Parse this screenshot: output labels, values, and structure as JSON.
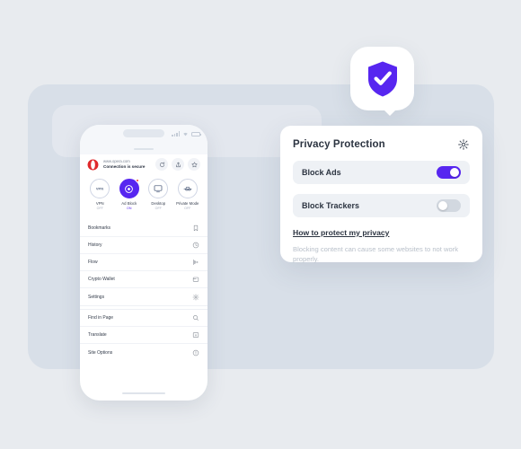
{
  "phone": {
    "status_bar": {
      "signal_icon": "signal-bars-icon",
      "wifi_icon": "wifi-icon",
      "battery_icon": "battery-icon"
    },
    "address_bar": {
      "brand_icon": "opera-logo-icon",
      "url": "www.opera.com",
      "security_text": "Connection is secure",
      "actions": [
        {
          "name": "reload-button",
          "icon": "reload-icon"
        },
        {
          "name": "share-button",
          "icon": "share-icon"
        },
        {
          "name": "bookmark-button",
          "icon": "star-icon"
        }
      ]
    },
    "quick_actions": [
      {
        "label": "VPN",
        "state": "OFF",
        "active": false,
        "icon": "vpn-icon"
      },
      {
        "label": "Ad Block",
        "state": "ON",
        "active": true,
        "icon": "adblock-icon",
        "badge": true
      },
      {
        "label": "Desktop",
        "state": "OFF",
        "active": false,
        "icon": "desktop-icon"
      },
      {
        "label": "Private Mode",
        "state": "OFF",
        "active": false,
        "icon": "private-mode-icon"
      }
    ],
    "menu_group_1": [
      {
        "label": "Bookmarks",
        "icon": "bookmark-icon"
      },
      {
        "label": "History",
        "icon": "clock-icon"
      },
      {
        "label": "Flow",
        "icon": "flow-icon"
      },
      {
        "label": "Crypto Wallet",
        "icon": "wallet-icon"
      },
      {
        "label": "Settings",
        "icon": "gear-icon"
      }
    ],
    "menu_group_2": [
      {
        "label": "Find in Page",
        "icon": "search-icon"
      },
      {
        "label": "Translate",
        "icon": "translate-icon"
      },
      {
        "label": "Site Options",
        "icon": "info-icon"
      }
    ]
  },
  "shield_badge": {
    "icon": "shield-check-icon"
  },
  "panel": {
    "title": "Privacy Protection",
    "settings_icon": "gear-icon",
    "options": [
      {
        "label": "Block Ads",
        "enabled": true
      },
      {
        "label": "Block Trackers",
        "enabled": false
      }
    ],
    "link": "How to protect my privacy",
    "note": "Blocking content can cause some websites to not work properly."
  },
  "colors": {
    "page_background": "#e8ebef",
    "backdrop_card": "#d8dfe8",
    "backdrop_inner": "#e3e7ee",
    "accent": "#5726f0",
    "toggle_off": "#d2d8e0",
    "option_row": "#eef1f5",
    "text_primary": "#2c3441",
    "text_muted": "#b9c0ca",
    "badge_red": "#ff3b30"
  }
}
